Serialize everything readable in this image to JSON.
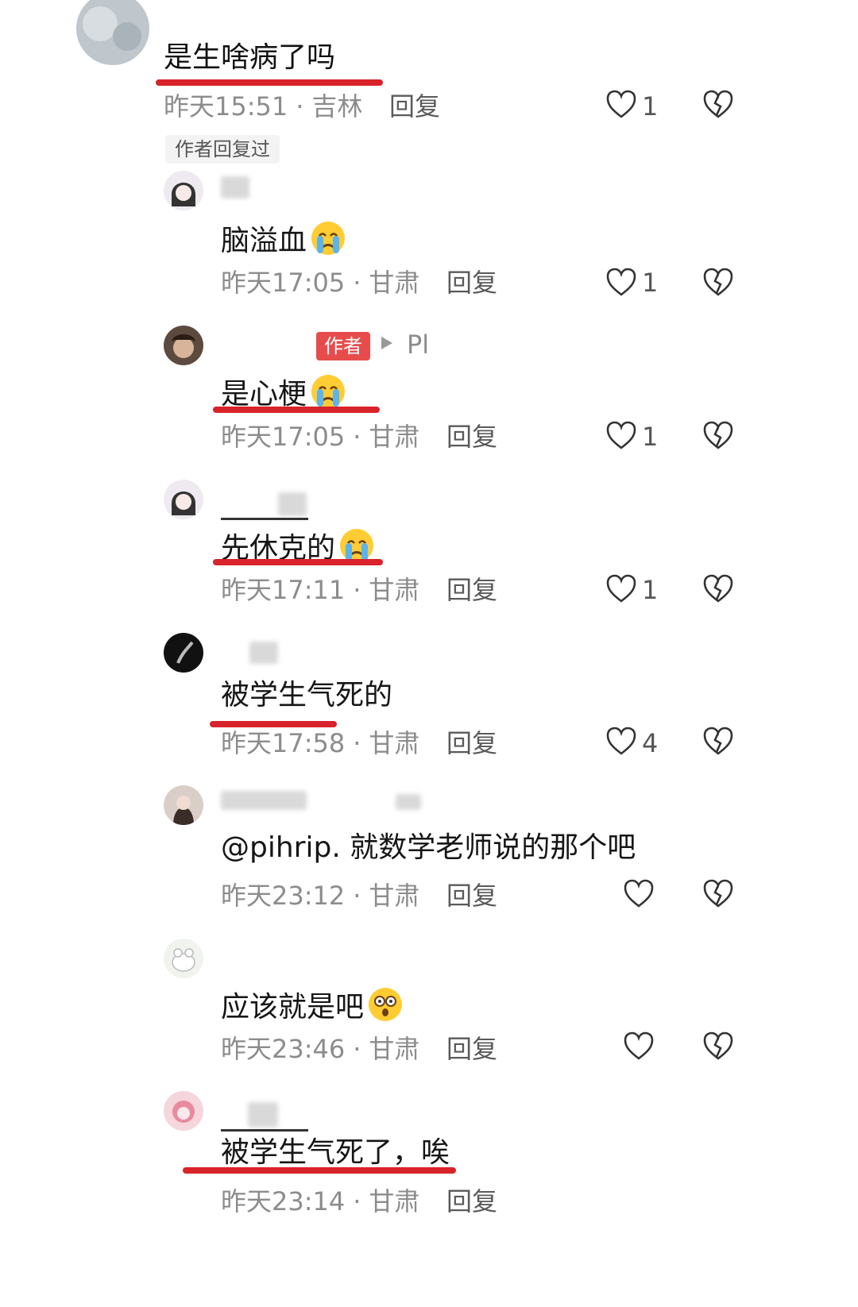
{
  "top_comment": {
    "text": "是生啥病了吗",
    "time": "昨天15:51",
    "location": "吉林",
    "reply_label": "回复",
    "likes": "1",
    "author_replied": "作者回复过"
  },
  "separator": "·",
  "replies": [
    {
      "text": "脑溢血",
      "emoji": "crying-face",
      "time": "昨天17:05",
      "location": "甘肃",
      "reply_label": "回复",
      "likes": "1"
    },
    {
      "text": "是心梗",
      "emoji": "crying-face",
      "time": "昨天17:05",
      "location": "甘肃",
      "reply_label": "回复",
      "likes": "1",
      "author_badge": "作者",
      "reply_to_partial": "Pl"
    },
    {
      "text": "先休克的",
      "emoji": "crying-face",
      "time": "昨天17:11",
      "location": "甘肃",
      "reply_label": "回复",
      "likes": "1"
    },
    {
      "text": "被学生气死的",
      "time": "昨天17:58",
      "location": "甘肃",
      "reply_label": "回复",
      "likes": "4"
    },
    {
      "text": "@pihrip. 就数学老师说的那个吧",
      "time": "昨天23:12",
      "location": "甘肃",
      "reply_label": "回复",
      "likes": ""
    },
    {
      "text": "应该就是吧",
      "emoji": "shocked-face",
      "time": "昨天23:46",
      "location": "甘肃",
      "reply_label": "回复",
      "likes": ""
    },
    {
      "text": "被学生气死了，唉",
      "time": "昨天23:14",
      "location": "甘肃",
      "reply_label": "回复",
      "likes": ""
    }
  ],
  "colors": {
    "underline": "#d8232a",
    "author_badge": "#e74c4c",
    "meta_gray": "#8c8c8c"
  }
}
